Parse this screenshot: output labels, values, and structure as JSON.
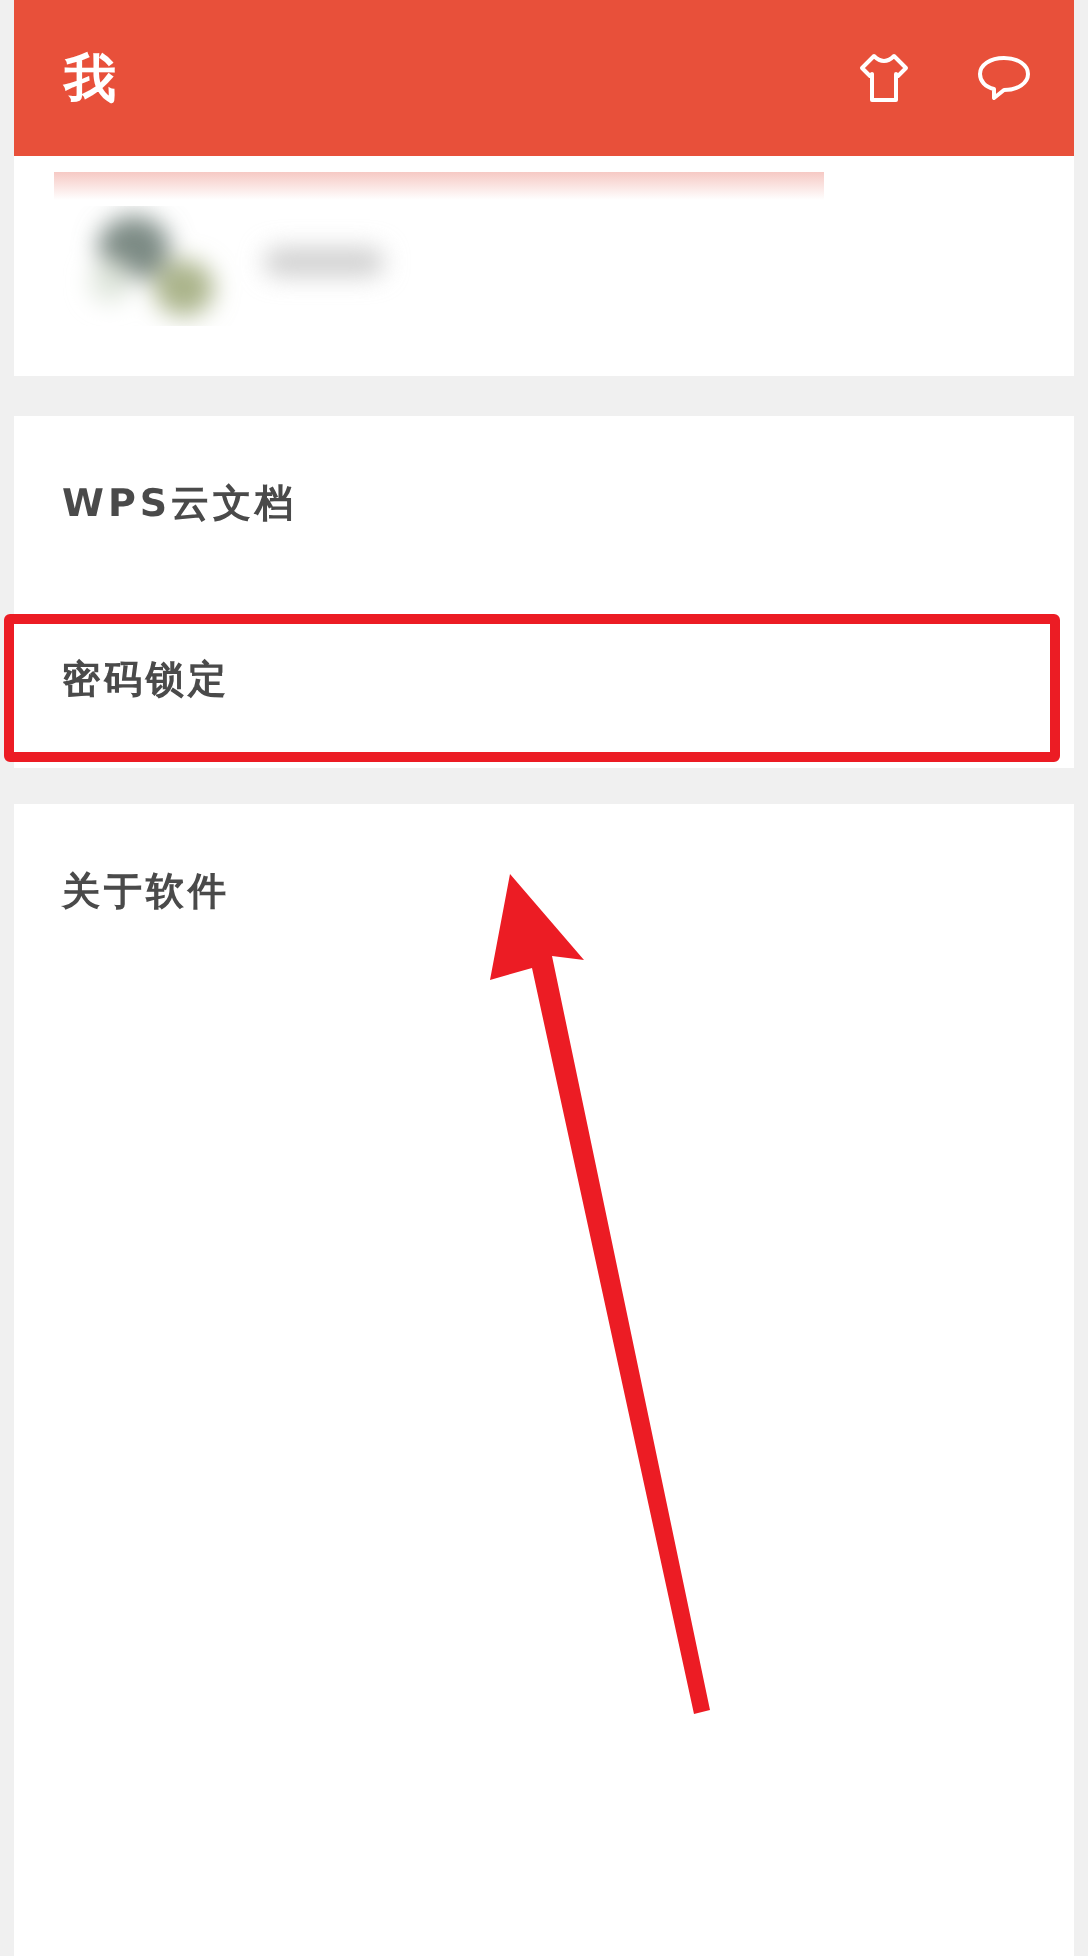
{
  "header": {
    "title": "我"
  },
  "sections": [
    {
      "items": [
        {
          "label": "WPS云文档",
          "highlighted": false
        },
        {
          "label": "密码锁定",
          "highlighted": true
        }
      ]
    },
    {
      "items": [
        {
          "label": "关于软件",
          "highlighted": false
        }
      ]
    }
  ]
}
